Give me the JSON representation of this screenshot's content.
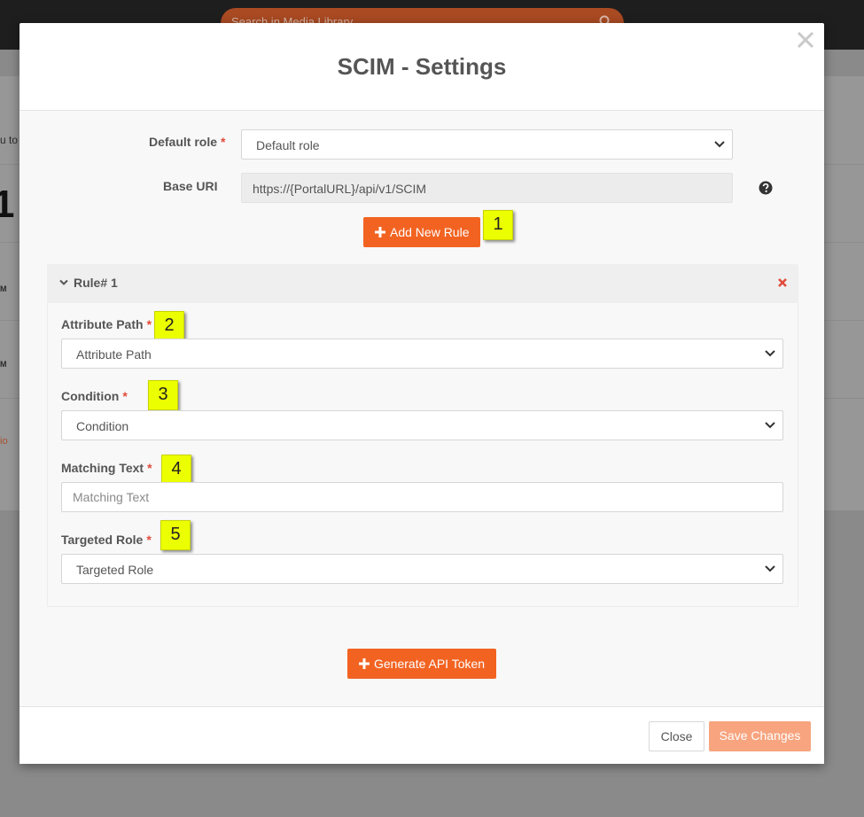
{
  "background": {
    "search_placeholder": "Search in Media Library",
    "fragments": [
      "u to",
      "1",
      "M",
      "M",
      "io"
    ]
  },
  "modal": {
    "title": "SCIM - Settings",
    "default_role": {
      "label": "Default role",
      "required_mark": "*",
      "value": "Default role"
    },
    "base_uri": {
      "label": "Base URI",
      "value": "https://{PortalURL}/api/v1/SCIM"
    },
    "add_rule_label": "Add New Rule",
    "rule": {
      "title": "Rule# 1",
      "attribute_path": {
        "label": "Attribute Path",
        "required_mark": "*",
        "value": "Attribute Path"
      },
      "condition": {
        "label": "Condition",
        "required_mark": "*",
        "value": "Condition"
      },
      "matching_text": {
        "label": "Matching Text",
        "required_mark": "*",
        "placeholder": "Matching Text"
      },
      "targeted_role": {
        "label": "Targeted Role",
        "required_mark": "*",
        "value": "Targeted Role"
      }
    },
    "generate_token_label": "Generate API Token",
    "footer": {
      "close_label": "Close",
      "save_label": "Save Changes"
    }
  },
  "callouts": [
    "1",
    "2",
    "3",
    "4",
    "5"
  ],
  "colors": {
    "accent": "#f26322",
    "callout": "#ecff00",
    "required": "#e04b3c",
    "save_disabled": "#f7a47f"
  }
}
